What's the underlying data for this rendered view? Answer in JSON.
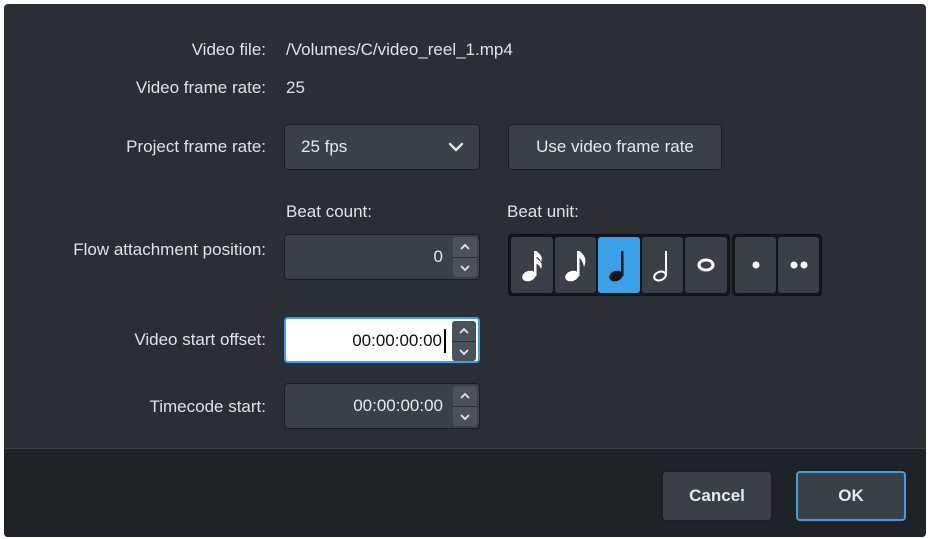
{
  "fields": {
    "video_file_label": "Video file:",
    "video_file_value": "/Volumes/C/video_reel_1.mp4",
    "video_frame_rate_label": "Video frame rate:",
    "video_frame_rate_value": "25",
    "project_frame_rate_label": "Project frame rate:",
    "project_frame_rate_value": "25 fps",
    "use_video_frame_rate_label": "Use video frame rate",
    "beat_count_header": "Beat count:",
    "beat_unit_header": "Beat unit:",
    "flow_attachment_label": "Flow attachment position:",
    "beat_count_value": "0",
    "video_start_offset_label": "Video start offset:",
    "video_start_offset_value": "00:00:00:00",
    "timecode_start_label": "Timecode start:",
    "timecode_start_value": "00:00:00:00"
  },
  "beat_units": [
    {
      "icon": "sixteenth-note-icon",
      "selected": false
    },
    {
      "icon": "eighth-note-icon",
      "selected": false
    },
    {
      "icon": "quarter-note-icon",
      "selected": true
    },
    {
      "icon": "half-note-icon",
      "selected": false
    },
    {
      "icon": "whole-note-icon",
      "selected": false
    }
  ],
  "dot_options": [
    {
      "icon": "single-dot-icon"
    },
    {
      "icon": "double-dot-icon"
    }
  ],
  "footer": {
    "cancel_label": "Cancel",
    "ok_label": "OK"
  },
  "colors": {
    "accent": "#3aa0e8",
    "dialog_bg": "#2a2f35",
    "control_bg": "#3a4048"
  }
}
